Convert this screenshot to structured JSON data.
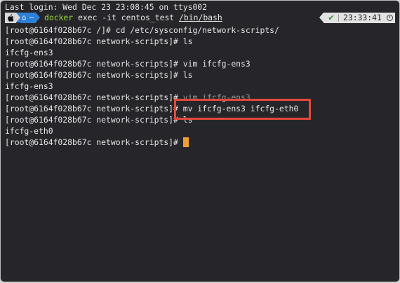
{
  "terminal": {
    "last_login": "Last login: Wed Dec 23 23:08:45 on ttys002",
    "prompt_bar": {
      "apple_icon": "apple-icon",
      "home_icon": "home-icon",
      "dir_label": "~",
      "command": {
        "name": "docker",
        "args": " exec -it centos_test ",
        "path": "/bin/bash"
      },
      "status_icon": "checkmark-icon",
      "status_text": "✔",
      "time": "23:33:41",
      "clock_icon": "clock-icon"
    },
    "lines": [
      "[root@6164f028b67c /]# cd /etc/sysconfig/network-scripts/",
      "[root@6164f028b67c network-scripts]# ls",
      "ifcfg-ens3",
      "[root@6164f028b67c network-scripts]# vim ifcfg-ens3",
      "[root@6164f028b67c network-scripts]# ls",
      "ifcfg-ens3",
      "[root@6164f028b67c network-scripts]# vim ifcfg-ens3",
      "[root@6164f028b67c network-scripts]# mv ifcfg-ens3 ifcfg-eth0",
      "[root@6164f028b67c network-scripts]# ls",
      "ifcfg-eth0",
      "[root@6164f028b67c network-scripts]# "
    ],
    "colors": {
      "background": "#26262a",
      "text": "#e6e6e6",
      "command_green": "#9bdc3e",
      "segment_blue": "#2c7fd6",
      "cursor": "#f0a030",
      "highlight_red": "#e5483b"
    }
  }
}
